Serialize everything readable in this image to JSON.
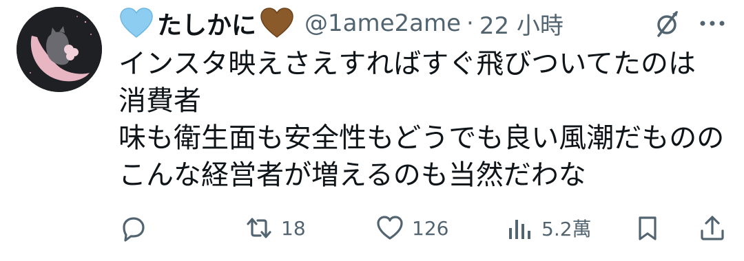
{
  "tweet": {
    "author_name": "たしかに",
    "left_emoji_icon": "light-blue-heart",
    "right_emoji_icon": "brown-heart",
    "handle": "@1ame2ame",
    "separator": "·",
    "time": "22 小時",
    "body_lines": [
      "インスタ映えさえすればすぐ飛びついてたのは",
      "消費者",
      "味も衛生面も安全性もどうでも良い風潮だものの",
      "こんな経営者が増えるのも当然だわな"
    ]
  },
  "actions": {
    "reply_icon": "reply-icon",
    "retweet_icon": "retweet-icon",
    "retweet_count": "18",
    "like_icon": "heart-icon",
    "like_count": "126",
    "views_icon": "bar-chart-icon",
    "views_count": "5.2萬",
    "bookmark_icon": "bookmark-icon",
    "share_icon": "share-icon"
  },
  "colors": {
    "text_primary": "#0f1419",
    "text_secondary": "#536471",
    "light_blue_heart": "#8ecdf2",
    "brown_heart": "#8b5a2b"
  }
}
